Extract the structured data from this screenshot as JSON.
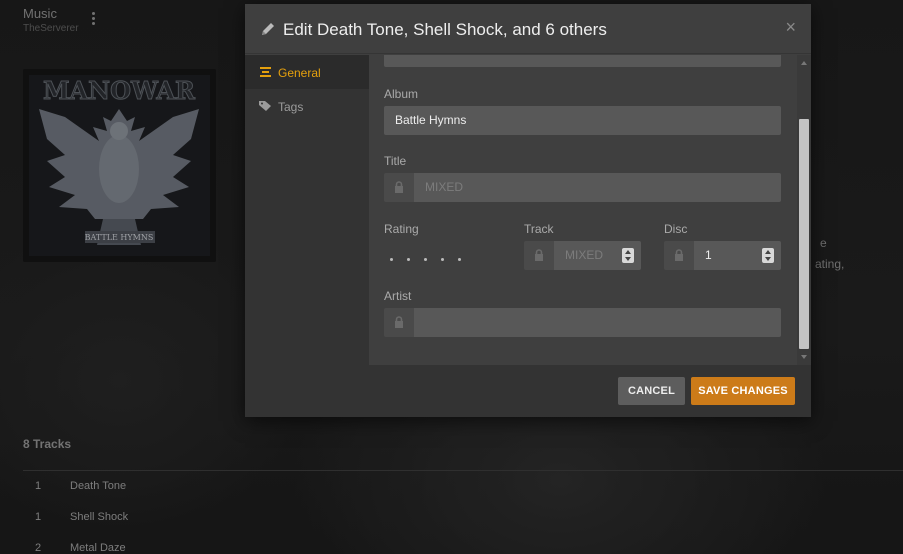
{
  "background": {
    "section_title": "Music",
    "server_name": "TheServerer",
    "menu_icon": "kebab-icon",
    "album_art_caption": "MANOWAR",
    "album_art_subcaption": "BATTLE HYMNS",
    "fragment_1": "e",
    "fragment_2": "ating,",
    "tracks_heading": "8 Tracks",
    "tracks": [
      {
        "num": "1",
        "name": "Death Tone"
      },
      {
        "num": "1",
        "name": "Shell Shock"
      },
      {
        "num": "2",
        "name": "Metal Daze"
      }
    ]
  },
  "modal": {
    "title": "Edit Death Tone, Shell Shock, and 6 others",
    "close_glyph": "×",
    "sidebar": [
      {
        "label": "General",
        "icon": "list-icon",
        "active": true
      },
      {
        "label": "Tags",
        "icon": "tag-icon",
        "active": false
      }
    ],
    "fields": {
      "album_label": "Album",
      "album_value": "Battle Hymns",
      "title_label": "Title",
      "title_placeholder": "MIXED",
      "rating_label": "Rating",
      "rating_value": 0,
      "track_label": "Track",
      "track_placeholder": "MIXED",
      "disc_label": "Disc",
      "disc_value": "1",
      "artist_label": "Artist",
      "artist_value": ""
    },
    "buttons": {
      "cancel": "CANCEL",
      "save": "SAVE CHANGES"
    }
  },
  "colors": {
    "accent": "#e5a00d",
    "save_button": "#cc7b19",
    "modal_bg": "#3f3f3f"
  }
}
